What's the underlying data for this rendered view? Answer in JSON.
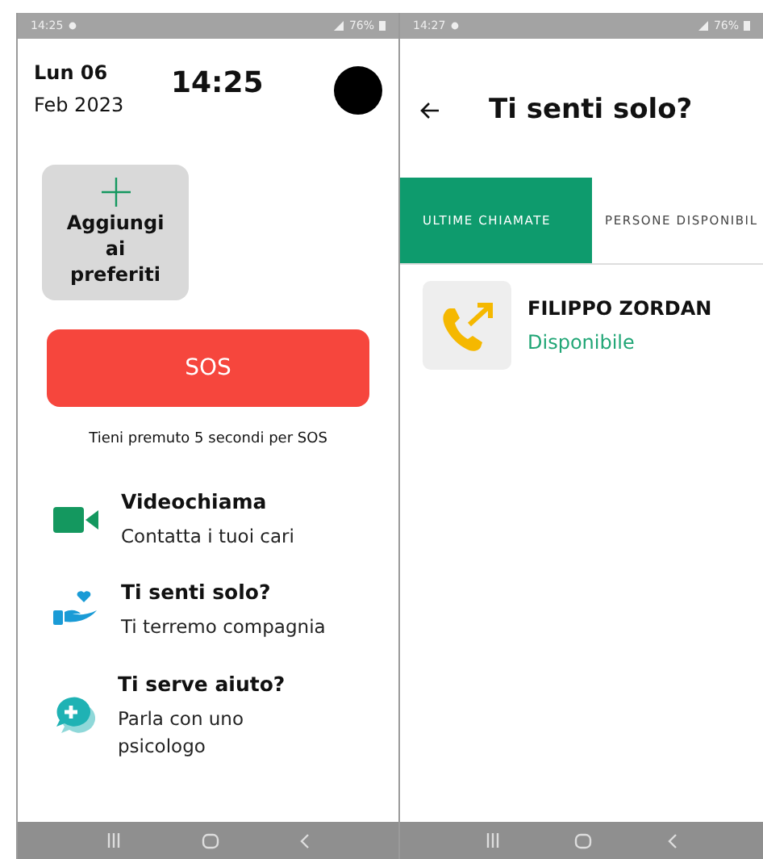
{
  "left_screen": {
    "status_bar": {
      "time": "14:25",
      "battery": "76%"
    },
    "date_day": "Lun 06",
    "date_month": "Feb 2023",
    "clock": "14:25",
    "favorite_tile": "Aggiungi ai preferiti",
    "sos_button": "SOS",
    "sos_hint": "Tieni premuto 5 secondi per SOS",
    "menu": [
      {
        "kind": "video",
        "title": "Videochiama",
        "subtitle": "Contatta i tuoi cari"
      },
      {
        "kind": "company",
        "title": "Ti senti solo?",
        "subtitle": "Ti terremo compagnia"
      },
      {
        "kind": "help",
        "title": "Ti serve aiuto?",
        "subtitle": "Parla con uno psicologo"
      }
    ]
  },
  "right_screen": {
    "status_bar": {
      "time": "14:27",
      "battery": "76%"
    },
    "title": "Ti senti solo?",
    "tabs": [
      {
        "label": "ULTIME CHIAMATE",
        "selected": true
      },
      {
        "label": "PERSONE DISPONIBIL",
        "selected": false
      }
    ],
    "contacts": [
      {
        "name": "FILIPPO ZORDAN",
        "status": "Disponibile"
      }
    ]
  }
}
